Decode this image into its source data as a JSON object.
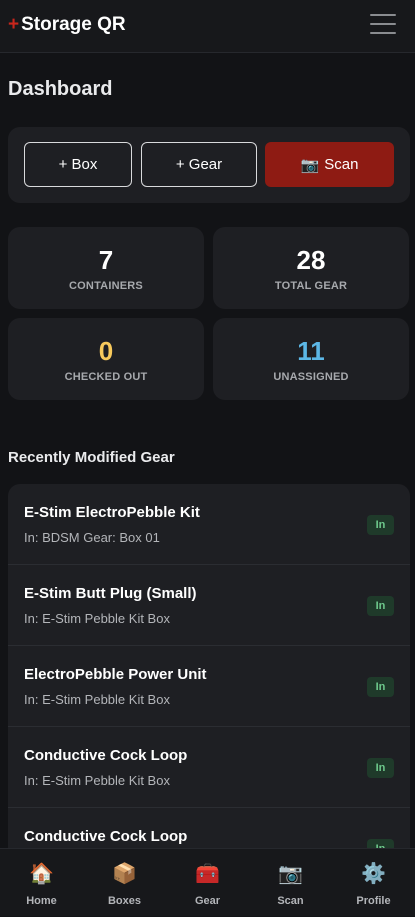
{
  "header": {
    "brand_mark": "+",
    "title": "Storage QR"
  },
  "page_title": "Dashboard",
  "actions": {
    "box_label": "+ Box",
    "gear_label": "+ Gear",
    "scan_icon": "📷",
    "scan_label": "Scan"
  },
  "stats": [
    {
      "value": "7",
      "label": "CONTAINERS",
      "color": "#ffffff"
    },
    {
      "value": "28",
      "label": "TOTAL GEAR",
      "color": "#ffffff"
    },
    {
      "value": "0",
      "label": "CHECKED OUT",
      "color": "#f7c95c"
    },
    {
      "value": "11",
      "label": "UNASSIGNED",
      "color": "#5cb7e6"
    }
  ],
  "recent_title": "Recently Modified Gear",
  "recent": [
    {
      "name": "E-Stim ElectroPebble Kit",
      "location": "In: BDSM Gear: Box 01",
      "status": "In"
    },
    {
      "name": "E-Stim Butt Plug (Small)",
      "location": "In: E-Stim Pebble Kit Box",
      "status": "In"
    },
    {
      "name": "ElectroPebble Power Unit",
      "location": "In: E-Stim Pebble Kit Box",
      "status": "In"
    },
    {
      "name": "Conductive Cock Loop",
      "location": "In: E-Stim Pebble Kit Box",
      "status": "In"
    },
    {
      "name": "Conductive Cock Loop",
      "location": "",
      "status": "In"
    }
  ],
  "nav": [
    {
      "icon": "🏠",
      "label": "Home"
    },
    {
      "icon": "📦",
      "label": "Boxes"
    },
    {
      "icon": "🧰",
      "label": "Gear"
    },
    {
      "icon": "📷",
      "label": "Scan"
    },
    {
      "icon": "⚙️",
      "label": "Profile"
    }
  ]
}
